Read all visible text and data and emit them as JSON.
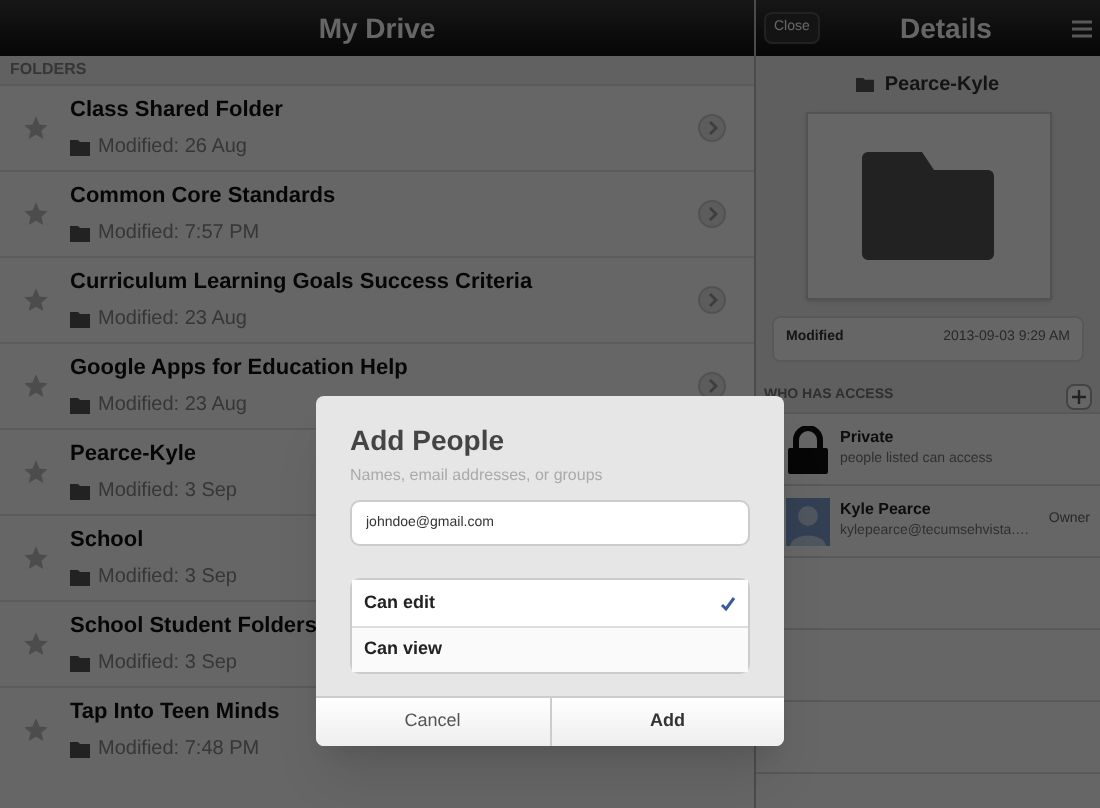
{
  "left_panel": {
    "title": "My Drive",
    "section": "FOLDERS",
    "folders": [
      {
        "name": "Class Shared Folder",
        "modified": "Modified: 26 Aug"
      },
      {
        "name": "Common Core Standards",
        "modified": "Modified: 7:57 PM"
      },
      {
        "name": "Curriculum Learning Goals Success Criteria",
        "modified": "Modified: 23 Aug"
      },
      {
        "name": "Google Apps for Education Help",
        "modified": "Modified: 23 Aug"
      },
      {
        "name": "Pearce-Kyle",
        "modified": "Modified: 3 Sep"
      },
      {
        "name": "School",
        "modified": "Modified: 3 Sep"
      },
      {
        "name": "School Student Folders",
        "modified": "Modified: 3 Sep"
      },
      {
        "name": "Tap Into Teen Minds",
        "modified": "Modified: 7:48 PM"
      }
    ]
  },
  "details": {
    "close": "Close",
    "title": "Details",
    "folder_name": "Pearce-Kyle",
    "modified_label": "Modified",
    "modified_value": "2013-09-03 9:29 AM",
    "access_heading": "WHO HAS ACCESS",
    "access": [
      {
        "kind": "lock",
        "name": "Private",
        "detail": "people listed can access"
      },
      {
        "kind": "person",
        "name": "Kyle Pearce",
        "detail": "kylepearce@tecumsehvista.…",
        "role": "Owner"
      }
    ]
  },
  "dialog": {
    "title": "Add People",
    "subtitle": "Names, email addresses, or groups",
    "value": "johndoe@gmail.com",
    "permissions": [
      {
        "label": "Can edit",
        "selected": true
      },
      {
        "label": "Can view",
        "selected": false
      }
    ],
    "cancel": "Cancel",
    "confirm": "Add"
  }
}
